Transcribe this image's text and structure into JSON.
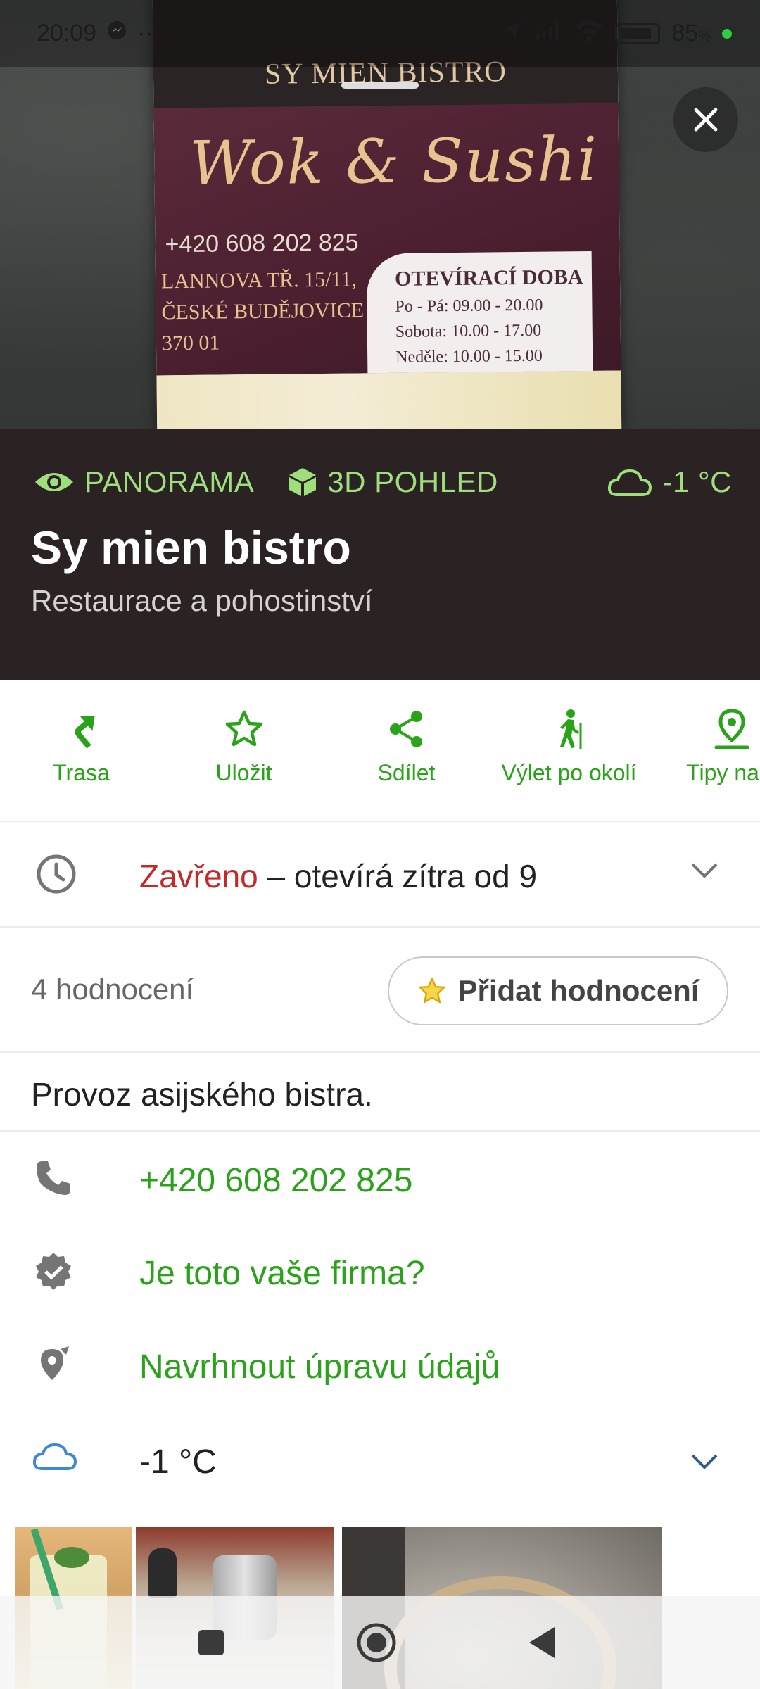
{
  "status_bar": {
    "time": "20:09",
    "more": "···",
    "battery": "85",
    "battery_unit": "%"
  },
  "hero_photo": {
    "flyer_name": "SY MIEN BISTRO",
    "flyer_script": "Wok & Sushi",
    "flyer_phone": "+420 608 202 825",
    "flyer_address": [
      "LANNOVA TŘ. 15/11,",
      "ČESKÉ BUDĚJOVICE",
      "370 01"
    ],
    "flyer_hours_title": "OTEVÍRACÍ DOBA",
    "flyer_hours": [
      "Po - Pá: 09.00 - 20.00",
      "Sobota: 10.00 - 17.00",
      "Neděle: 10.00 - 15.00"
    ]
  },
  "header": {
    "panorama_label": "PANORAMA",
    "view3d_label": "3D POHLED",
    "weather": "-1 °C",
    "title": "Sy mien bistro",
    "category": "Restaurace a pohostinství"
  },
  "actions": [
    {
      "label": "Trasa",
      "icon": "route-arrow-icon"
    },
    {
      "label": "Uložit",
      "icon": "star-icon"
    },
    {
      "label": "Sdílet",
      "icon": "share-icon"
    },
    {
      "label": "Výlet po okolí",
      "icon": "hiker-icon"
    },
    {
      "label": "Tipy na v",
      "icon": "location-pin-icon"
    }
  ],
  "hours": {
    "status": "Zavřeno",
    "detail": " – otevírá zítra od 9"
  },
  "rating": {
    "count": "4 hodnocení",
    "add_label": "Přidat hodnocení"
  },
  "description": "Provoz asijského bistra.",
  "info": {
    "phone": "+420 608 202 825",
    "claim": "Je toto vaše firma?",
    "suggest": "Navrhnout úpravu údajů",
    "weather": "-1 °C"
  },
  "colors": {
    "accent_green": "#2aa31a",
    "light_green": "#9fde7c",
    "closed_red": "#c62828",
    "band_bg": "#2a2223"
  }
}
